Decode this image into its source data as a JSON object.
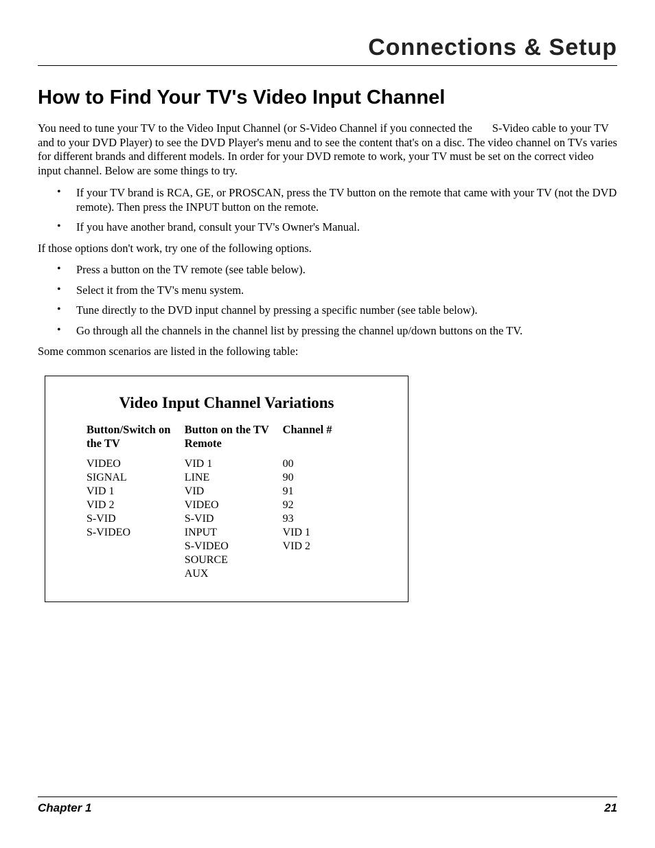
{
  "chapter_header": "Connections & Setup",
  "section_title": "How to Find Your TV's Video Input Channel",
  "intro_paragraph": "You need to tune your TV to the Video Input Channel (or S-Video Channel if you connected the       S-Video cable to your TV and to your DVD Player) to see the DVD Player's menu and to see the content that's on a disc. The video channel on TVs varies for different brands and different models. In order for your DVD remote to work, your TV must be set on the correct video input channel. Below are some things to try.",
  "bullets1": [
    "If your TV brand is RCA, GE, or PROSCAN, press the TV button on the remote that came with your TV (not the DVD remote). Then press the INPUT button on the remote.",
    "If you have another brand, consult your TV's Owner's Manual."
  ],
  "middle_para": "If those options don't work, try one of the following options.",
  "bullets2": [
    "Press a button on the TV remote (see table below).",
    "Select it from the TV's menu system.",
    "Tune directly to the DVD input channel by pressing a specific number (see table below).",
    "Go through all the channels in the channel list by pressing the channel up/down buttons on the TV."
  ],
  "closing_para": "Some common scenarios are listed in the following table:",
  "table": {
    "title": "Video Input Channel Variations",
    "headers": {
      "col1": "Button/Switch on the TV",
      "col2": "Button on the TV Remote",
      "col3": "Channel #"
    },
    "col1_values": "VIDEO\nSIGNAL\nVID 1\nVID 2\nS-VID\nS-VIDEO",
    "col2_values": "VID 1\nLINE\nVID\nVIDEO\nS-VID\nINPUT\nS-VIDEO\nSOURCE\nAUX",
    "col3_values": "00\n90\n91\n92\n93\nVID 1\nVID 2"
  },
  "footer": {
    "chapter": "Chapter 1",
    "page": "21"
  }
}
